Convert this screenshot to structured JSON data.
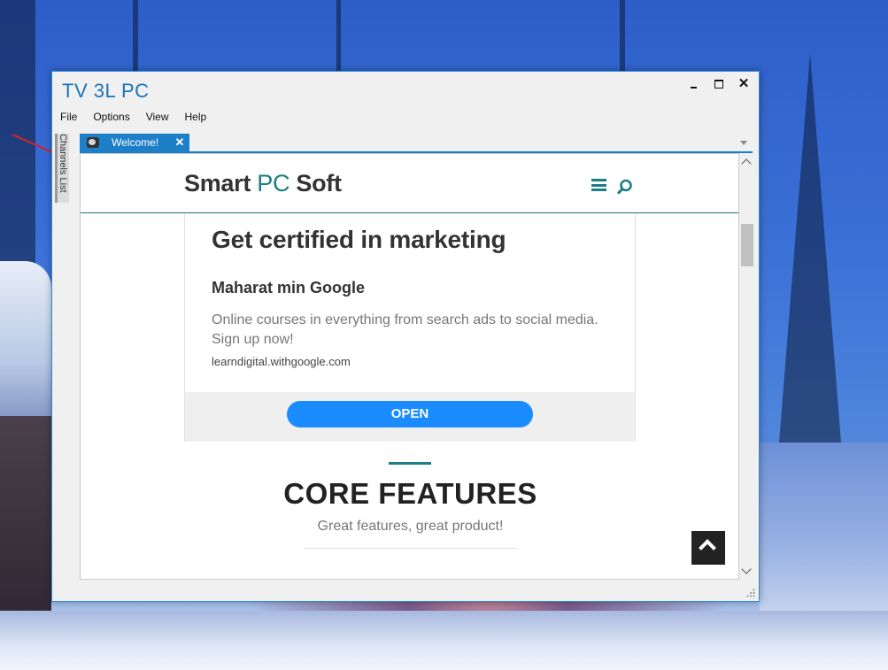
{
  "window": {
    "title": "TV 3L PC",
    "controls": {
      "minimize": "",
      "maximize": "",
      "close": "✕"
    }
  },
  "menu": [
    "File",
    "Options",
    "View",
    "Help"
  ],
  "side_panel": {
    "label": "Channels List"
  },
  "tabs": [
    {
      "label": "Welcome!",
      "close": "✕"
    }
  ],
  "site": {
    "logo": {
      "part1": "Smart",
      "part2": "PC",
      "part3": "Soft"
    },
    "ad": {
      "title": "Get certified in marketing",
      "subtitle": "Maharat min Google",
      "description": "Online courses in everything from search ads to social media. Sign up now!",
      "url": "learndigital.withgoogle.com",
      "button": "OPEN"
    },
    "features": {
      "title": "CORE FEATURES",
      "subtitle": "Great features, great product!"
    }
  },
  "colors": {
    "title_blue": "#1a73b8",
    "tab_blue": "#1e7fc9",
    "brand_teal": "#1a7f86",
    "button_blue": "#1a8cff"
  },
  "icons": [
    "hamburger-menu-icon",
    "search-icon",
    "back-to-top-icon",
    "tab-favicon-icon",
    "resize-grip-icon"
  ]
}
